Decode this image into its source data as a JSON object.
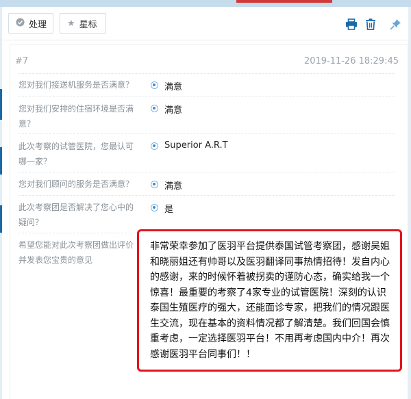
{
  "toolbar": {
    "process_label": "处理",
    "star_label": "星标",
    "icons": [
      "print-icon",
      "trash-icon",
      "pin-icon"
    ],
    "accent_color": "#1b6aa8"
  },
  "message": {
    "number": "#7",
    "timestamp": "2019-11-26 18:29:45"
  },
  "survey": [
    {
      "question": "您对我们接送机服务是否满意？",
      "answer": "满意"
    },
    {
      "question": "您对我们安排的住宿环境是否满意？",
      "answer": "满意"
    },
    {
      "question": "此次考察的试管医院，您最认可哪一家？",
      "answer": "Superior A.R.T"
    },
    {
      "question": "您对我们顾问的服务是否满意？",
      "answer": "满意"
    },
    {
      "question": "此次考察团是否解决了您心中的疑问？",
      "answer": "是"
    }
  ],
  "feedback": {
    "question": "希望您能对此次考察团做出评价并发表您宝贵的意见",
    "text": "非常荣幸参加了医羽平台提供泰国试管考察团，感谢吴姐和晓丽姐还有帅哥以及医羽翻译同事热情招待！发自内心的感谢，来的时候怀着被拐卖的谨防心态，确实给我一个惊喜！最重要的考察了4家专业的试管医院！深刻的认识泰国生殖医疗的强大，还能面诊专家，把我们的情况跟医生交流，现在基本的资料情况都了解清楚。我们回国会慎重考虑，一定选择医羽平台！不用再考虑国内中介！再次感谢医羽平台同事们！！",
    "highlight_color": "#e0141c"
  }
}
